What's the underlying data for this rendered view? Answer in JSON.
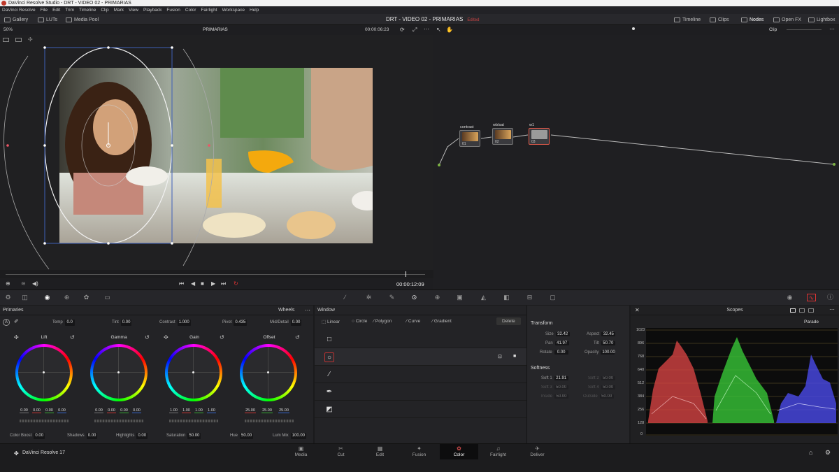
{
  "window": {
    "title": "DaVinci Resolve Studio - DRT - VIDEO 02 - PRIMARIAS"
  },
  "menu": [
    "DaVinci Resolve",
    "File",
    "Edit",
    "Trim",
    "Timeline",
    "Clip",
    "Mark",
    "View",
    "Playback",
    "Fusion",
    "Color",
    "Fairlight",
    "Workspace",
    "Help"
  ],
  "toolbar": {
    "gallery": "Gallery",
    "luts": "LUTs",
    "media_pool": "Media Pool",
    "project_title": "DRT - VIDEO 02 - PRIMARIAS",
    "edited": "Edited",
    "timeline": "Timeline",
    "clips": "Clips",
    "nodes": "Nodes",
    "open_fx": "Open FX",
    "lightbox": "Lightbox"
  },
  "viewer": {
    "zoom": "50%",
    "clip_name": "PRIMARIAS",
    "timecode_top": "00:00:06:23",
    "timecode_bottom": "00:00:12:09",
    "node_mode": "Clip"
  },
  "nodes": [
    {
      "label": "contrast",
      "num": "01"
    },
    {
      "label": "wb/sat",
      "num": "02"
    },
    {
      "label": "w1",
      "num": "03"
    }
  ],
  "primaries": {
    "title": "Primaries",
    "mode": "Wheels",
    "temp_label": "Temp",
    "temp": "0.0",
    "tint_label": "Tint",
    "tint": "0.00",
    "contrast_label": "Contrast",
    "contrast": "1.000",
    "pivot_label": "Pivot",
    "pivot": "0.435",
    "middetail_label": "Mid/Detail",
    "middetail": "0.00",
    "wheels": [
      {
        "name": "Lift",
        "vals": [
          "0.00",
          "0.00",
          "0.00",
          "0.00"
        ]
      },
      {
        "name": "Gamma",
        "vals": [
          "0.00",
          "0.00",
          "0.00",
          "0.00"
        ]
      },
      {
        "name": "Gain",
        "vals": [
          "1.00",
          "1.00",
          "1.00",
          "1.00"
        ]
      },
      {
        "name": "Offset",
        "vals": [
          "25.00",
          "25.00",
          "25.00"
        ]
      }
    ],
    "color_boost_label": "Color Boost",
    "color_boost": "0.00",
    "shadows_label": "Shadows",
    "shadows": "0.00",
    "highlights_label": "Highlights",
    "highlights": "0.00",
    "saturation_label": "Saturation",
    "saturation": "50.00",
    "hue_label": "Hue",
    "hue": "50.00",
    "lummix_label": "Lum Mix",
    "lummix": "100.00"
  },
  "window_panel": {
    "title": "Window",
    "tools": [
      "Linear",
      "Circle",
      "Polygon",
      "Curve",
      "Gradient"
    ],
    "delete": "Delete"
  },
  "transform": {
    "title": "Transform",
    "size_label": "Size",
    "size": "32.42",
    "aspect_label": "Aspect",
    "aspect": "32.45",
    "pan_label": "Pan",
    "pan": "41.97",
    "tilt_label": "Tilt",
    "tilt": "50.70",
    "rotate_label": "Rotate",
    "rotate": "0.00",
    "opacity_label": "Opacity",
    "opacity": "100.00",
    "softness_title": "Softness",
    "soft1_label": "Soft 1",
    "soft1": "21.91",
    "soft2_label": "Soft 2",
    "soft2": "50.00",
    "soft3_label": "Soft 3",
    "soft3": "50.00",
    "soft4_label": "Soft 4",
    "soft4": "50.00",
    "inside_label": "Inside",
    "inside": "50.00",
    "outside_label": "Outside",
    "outside": "50.00"
  },
  "scopes": {
    "title": "Scopes",
    "mode": "Parade",
    "ticks": [
      "1023",
      "896",
      "768",
      "640",
      "512",
      "384",
      "256",
      "128",
      "0"
    ]
  },
  "pages": [
    "Media",
    "Cut",
    "Edit",
    "Fusion",
    "Color",
    "Fairlight",
    "Deliver"
  ],
  "brand": "DaVinci Resolve 17"
}
